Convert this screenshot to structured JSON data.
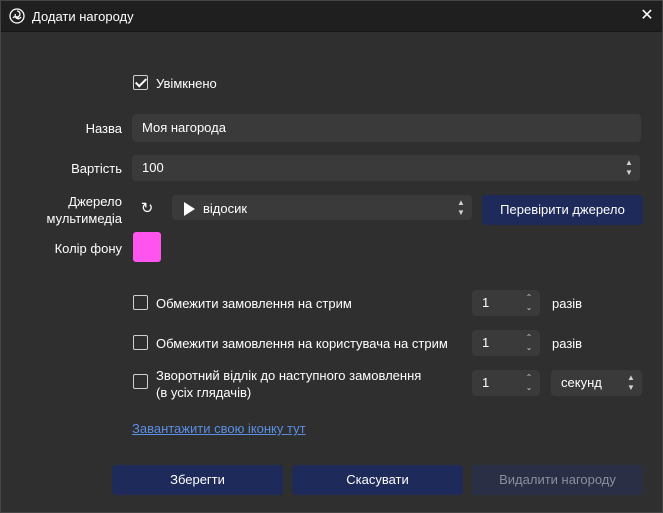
{
  "window": {
    "title": "Додати нагороду"
  },
  "enabled": {
    "label": "Увімкнено",
    "checked": true
  },
  "name": {
    "label": "Назва",
    "value": "Моя нагорода"
  },
  "cost": {
    "label": "Вартість",
    "value": "100"
  },
  "media": {
    "label_line1": "Джерело",
    "label_line2": "мультимедіа",
    "source": "відосик",
    "check_button": "Перевірити джерело"
  },
  "bg_color": {
    "label": "Колір фону",
    "color": "#ff55ee"
  },
  "limits": [
    {
      "label": "Обмежити замовлення на стрим",
      "checked": false,
      "value": "1",
      "unit": "разів"
    },
    {
      "label": "Обмежити замовлення на користувача на стрим",
      "checked": false,
      "value": "1",
      "unit": "разів"
    }
  ],
  "cooldown": {
    "label_line1": "Зворотний відлік до наступного замовлення",
    "label_line2": "(в усіх глядачів)",
    "checked": false,
    "value": "1",
    "unit": "секунд"
  },
  "upload_link": "Завантажити свою іконку тут",
  "buttons": {
    "save": "Зберегти",
    "cancel": "Скасувати",
    "delete": "Видалити нагороду"
  },
  "colors": {
    "background": "#2f2f2f",
    "titlebar": "#1f1f1f",
    "field": "#3a3a3a",
    "button_primary": "#1e2a5a",
    "button_disabled": "#2a2f45",
    "link": "#5a8fe6"
  }
}
